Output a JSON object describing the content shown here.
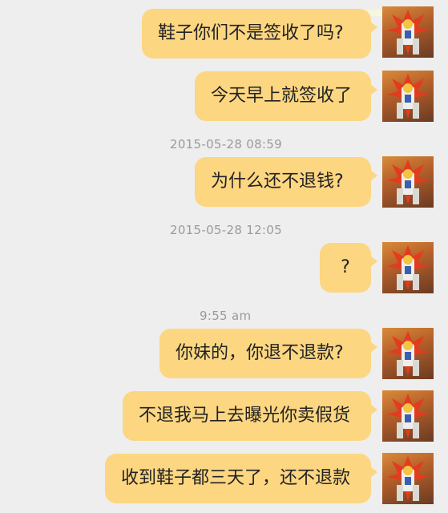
{
  "messages": [
    {
      "text": "鞋子你们不是签收了吗?"
    },
    {
      "text": "今天早上就签收了"
    },
    {
      "text": "为什么还不退钱?"
    },
    {
      "text": "?"
    },
    {
      "text": "你妹的，你退不退款?"
    },
    {
      "text": "不退我马上去曝光你卖假货"
    },
    {
      "text": "收到鞋子都三天了，还不退款"
    }
  ],
  "timestamps": [
    "2015-05-28 08:59",
    "2015-05-28 12:05",
    "9:55 am"
  ],
  "colors": {
    "bubble": "#fcd681",
    "background": "#eeeeee",
    "timestamp": "#9a9a9a"
  },
  "avatar_icon": "robot-avatar-icon"
}
